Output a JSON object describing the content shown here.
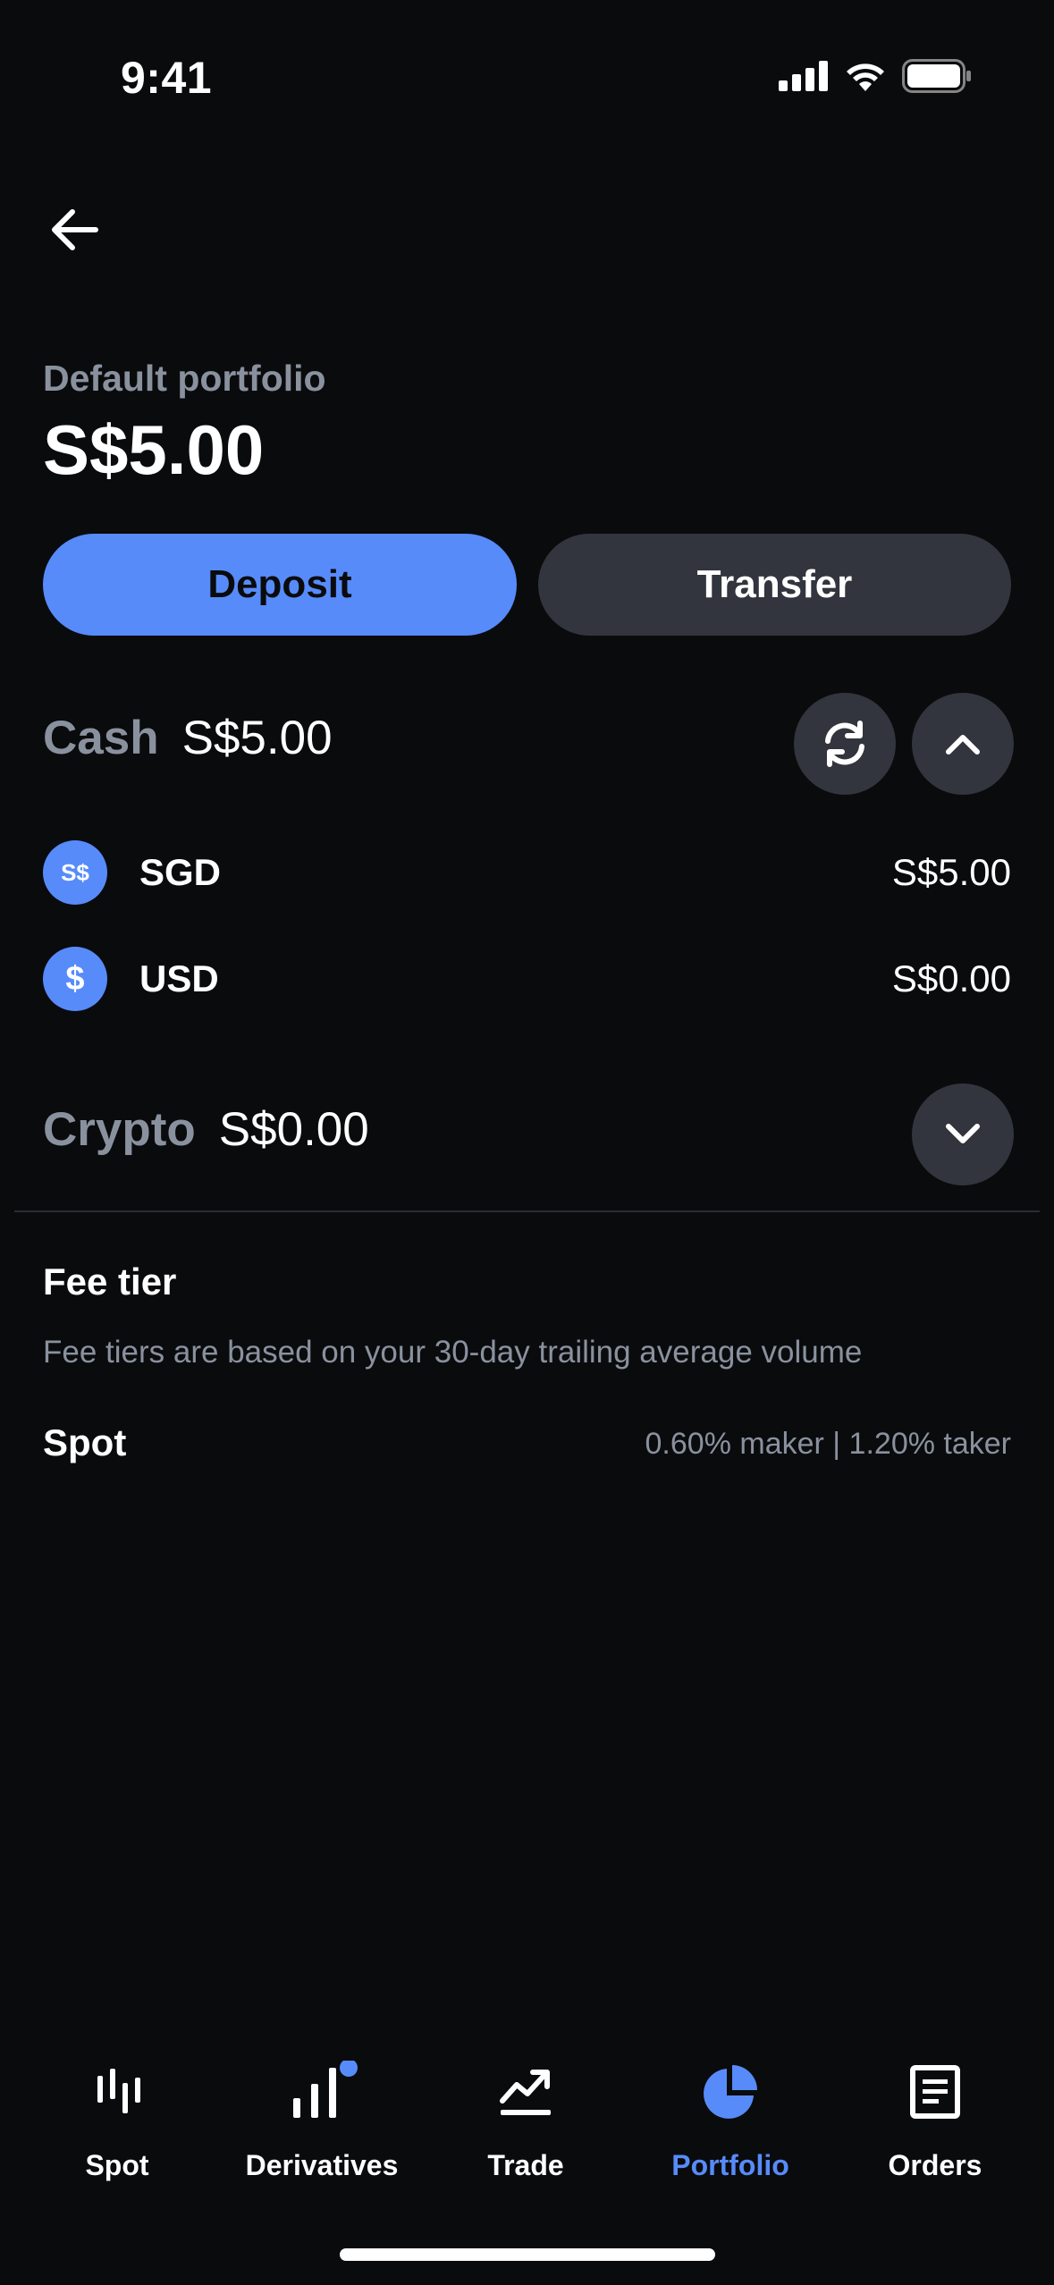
{
  "status_bar": {
    "time": "9:41"
  },
  "portfolio": {
    "label": "Default portfolio",
    "value": "S$5.00"
  },
  "actions": {
    "deposit_label": "Deposit",
    "transfer_label": "Transfer"
  },
  "cash": {
    "title": "Cash",
    "value": "S$5.00",
    "items": [
      {
        "icon_text": "S$",
        "name": "SGD",
        "value": "S$5.00"
      },
      {
        "icon_text": "$",
        "name": "USD",
        "value": "S$0.00"
      }
    ]
  },
  "crypto": {
    "title": "Crypto",
    "value": "S$0.00"
  },
  "fee_tier": {
    "title": "Fee tier",
    "description": "Fee tiers are based on your 30-day trailing average volume",
    "spot_label": "Spot",
    "spot_value": "0.60% maker | 1.20% taker"
  },
  "nav": {
    "items": [
      {
        "label": "Spot",
        "icon": "candlestick-icon"
      },
      {
        "label": "Derivatives",
        "icon": "bar-chart-icon"
      },
      {
        "label": "Trade",
        "icon": "trend-up-icon"
      },
      {
        "label": "Portfolio",
        "icon": "pie-chart-icon"
      },
      {
        "label": "Orders",
        "icon": "document-icon"
      }
    ],
    "active": "Portfolio"
  },
  "colors": {
    "accent": "#578bfa",
    "background": "#0a0b0d",
    "muted": "#8a919e",
    "surface": "#32353d"
  }
}
